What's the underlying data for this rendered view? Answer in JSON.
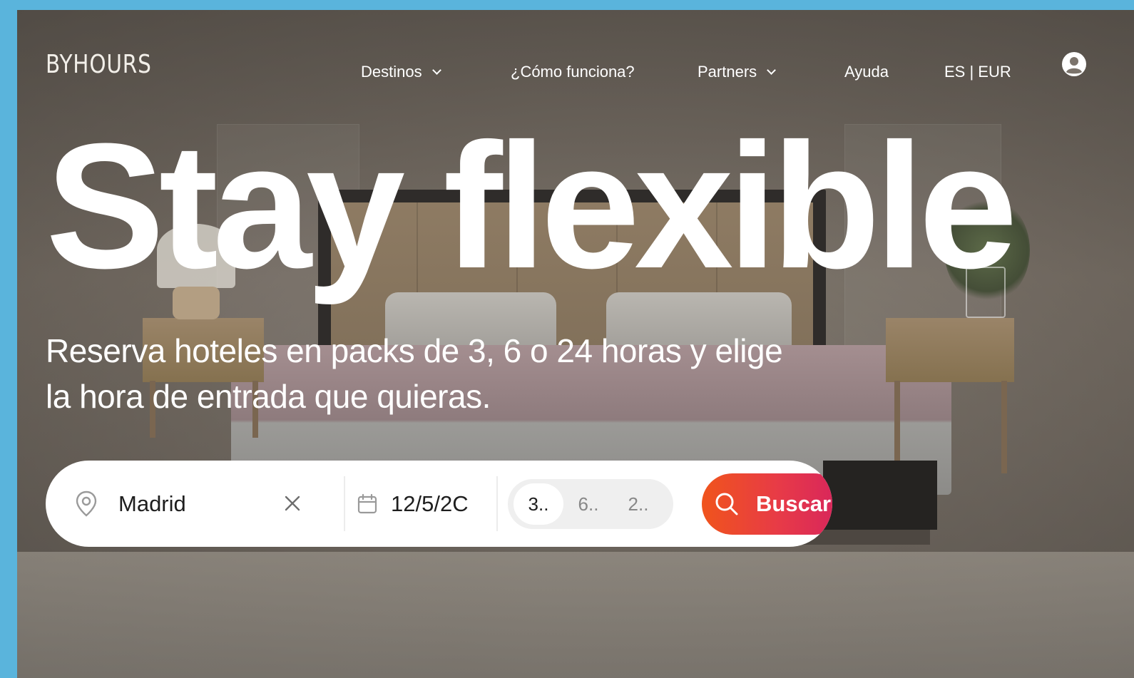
{
  "brand": {
    "logo_text": "BYHOURS"
  },
  "nav": {
    "items": [
      {
        "label": "Destinos",
        "has_dropdown": true
      },
      {
        "label": "¿Cómo funciona?",
        "has_dropdown": false
      },
      {
        "label": "Partners",
        "has_dropdown": true
      },
      {
        "label": "Ayuda",
        "has_dropdown": false
      },
      {
        "label": "ES | EUR",
        "has_dropdown": false
      }
    ],
    "user_icon": "user-circle-icon"
  },
  "hero": {
    "title": "Stay flexible",
    "subtitle": "Reserva hoteles en packs de 3, 6 o 24 horas y elige la hora de entrada que quieras."
  },
  "search": {
    "location_icon": "map-pin-icon",
    "location_value": "Madrid",
    "clear_icon": "close-icon",
    "date_icon": "calendar-icon",
    "date_value": "12/5/2C",
    "packs": [
      {
        "label": "3..",
        "selected": true
      },
      {
        "label": "6..",
        "selected": false
      },
      {
        "label": "2..",
        "selected": false
      }
    ],
    "button_label": "Buscar",
    "button_icon": "search-icon"
  },
  "colors": {
    "page_border": "#5ab4dc",
    "button_gradient_start": "#f0541c",
    "button_gradient_end": "#d6235e",
    "text_light": "#ffffff"
  }
}
